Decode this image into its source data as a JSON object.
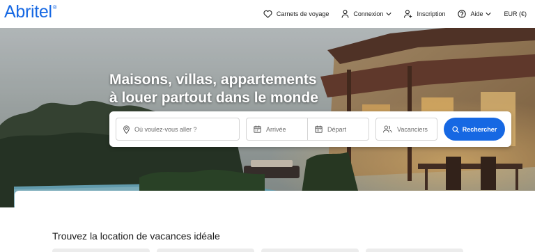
{
  "brand": {
    "name": "Abritel",
    "registered": "®",
    "color": "#1668e3"
  },
  "nav": {
    "trips": "Carnets de voyage",
    "login": "Connexion",
    "signup": "Inscription",
    "help": "Aide",
    "currency": "EUR (€)"
  },
  "hero": {
    "title_line1": "Maisons, villas, appartements",
    "title_line2": "à louer partout dans le monde"
  },
  "search": {
    "destination_placeholder": "Où voulez-vous aller ?",
    "arrival_placeholder": "Arrivée",
    "departure_placeholder": "Départ",
    "travelers_placeholder": "Vacanciers",
    "submit_label": "Rechercher",
    "accent": "#1668e3"
  },
  "main": {
    "section_title": "Trouvez la location de vacances idéale"
  },
  "icons": [
    "heart-icon",
    "user-icon",
    "user-plus-icon",
    "help-circle-icon",
    "chevron-down-icon",
    "location-pin-icon",
    "calendar-icon",
    "users-icon",
    "search-icon"
  ]
}
